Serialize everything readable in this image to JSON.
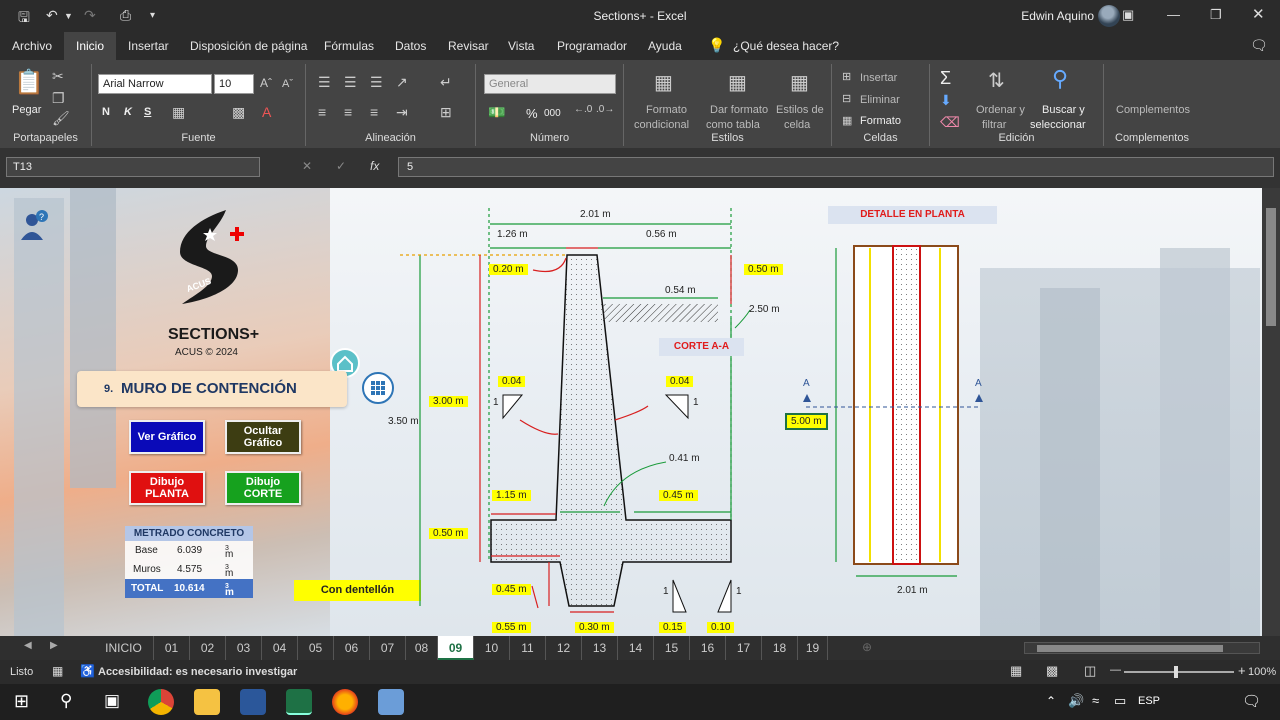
{
  "titlebar": {
    "title": "Sections+  -  Excel",
    "user": "Edwin Aquino"
  },
  "menu": [
    "Archivo",
    "Inicio",
    "Insertar",
    "Disposición de página",
    "Fórmulas",
    "Datos",
    "Revisar",
    "Vista",
    "Programador",
    "Ayuda",
    "¿Qué desea hacer?"
  ],
  "ribbon": {
    "paste": "Pegar",
    "font_name": "Arial Narrow",
    "font_size": "10",
    "bold": "N",
    "italic": "K",
    "underline": "S",
    "number_format": "General",
    "percent": "%",
    "thousands": "000",
    "fmt_cond_1": "Formato",
    "fmt_cond_2": "condicional",
    "fmt_table_1": "Dar formato",
    "fmt_table_2": "como tabla",
    "cell_styles_1": "Estilos de",
    "cell_styles_2": "celda",
    "insert": "Insertar",
    "delete": "Eliminar",
    "format": "Formato",
    "sort_1": "Ordenar y",
    "sort_2": "filtrar",
    "find_1": "Buscar y",
    "find_2": "seleccionar",
    "addins": "Complementos",
    "groups": [
      "Portapapeles",
      "Fuente",
      "Alineación",
      "Número",
      "Estilos",
      "Celdas",
      "Edición",
      "Complementos"
    ]
  },
  "formula": {
    "cell": "T13",
    "value": "5"
  },
  "app": {
    "brand": "SECTIONS+",
    "copyright": "ACUS © 2024",
    "logo_badge": "ACUS",
    "section_num": "9.",
    "section_title": "MURO DE CONTENCIÓN",
    "buttons": {
      "ver": "Ver Gráfico",
      "ocultar": "Ocultar Gráfico",
      "planta": "Dibujo PLANTA",
      "corte": "Dibujo CORTE"
    },
    "metrado": {
      "title": "METRADO CONCRETO",
      "rows": [
        {
          "label": "Base",
          "value": "6.039",
          "unit": "m"
        },
        {
          "label": "Muros",
          "value": "4.575",
          "unit": "m"
        },
        {
          "label": "TOTAL",
          "value": "10.614",
          "unit": "m"
        }
      ],
      "exp": "3"
    },
    "dentellon": "Con dentellón",
    "corte_label": "CORTE A-A",
    "planta_label": "DETALLE EN PLANTA"
  },
  "drawing": {
    "total_width": "2.01 m",
    "w_left": "1.26 m",
    "w_right": "0.56 m",
    "top_thick": "0.20 m",
    "top_offset": "0.50 m",
    "fill_width": "0.54 m",
    "h_right": "2.50 m",
    "total_height": "3.50 m",
    "stem_height": "3.00 m",
    "base_height": "0.50 m",
    "slope_left": "0.04",
    "slope_right": "0.04",
    "slope_one": "1",
    "stem_base": "0.41 m",
    "toe": "1.15 m",
    "heel": "0.45 m",
    "key_depth": "0.45 m",
    "key_left": "0.55 m",
    "key_width": "0.30 m",
    "key_slope_1": "0.15",
    "key_slope_2": "0.10",
    "plan_length": "5.00 m",
    "plan_width": "2.01 m",
    "section_mark": "A"
  },
  "tabs": [
    "INICIO",
    "01",
    "02",
    "03",
    "04",
    "05",
    "06",
    "07",
    "08",
    "09",
    "10",
    "11",
    "12",
    "13",
    "14",
    "15",
    "16",
    "17",
    "18",
    "19"
  ],
  "active_tab": "09",
  "status": {
    "ready": "Listo",
    "accessibility": "Accesibilidad: es necesario investigar",
    "zoom": "100%"
  },
  "taskbar": {
    "lang": "ESP"
  }
}
